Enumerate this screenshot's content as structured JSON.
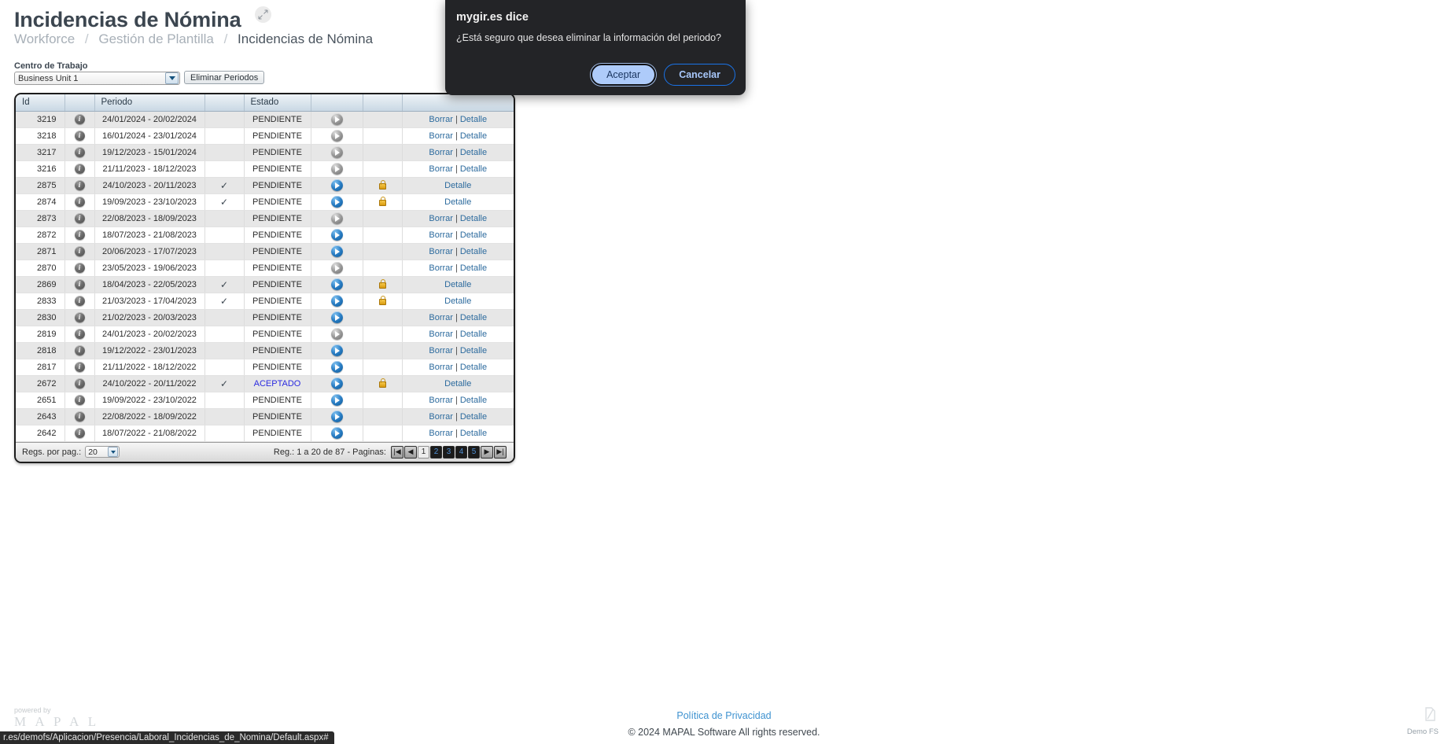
{
  "header": {
    "title": "Incidencias de Nómina",
    "expand_icon": "expand-arrows-icon",
    "breadcrumb": [
      {
        "label": "Workforce",
        "current": false
      },
      {
        "label": "Gestión de Plantilla",
        "current": false
      },
      {
        "label": "Incidencias de Nómina",
        "current": true
      }
    ],
    "separator": "/"
  },
  "filters": {
    "centro_label": "Centro de Trabajo",
    "centro_value": "Business Unit 1",
    "eliminar_button": "Eliminar Periodos"
  },
  "grid": {
    "columns": [
      "Id",
      "",
      "Periodo",
      "",
      "Estado",
      "",
      "",
      ""
    ],
    "rows": [
      {
        "id": "3219",
        "periodo": "24/01/2024 - 20/02/2024",
        "check": "",
        "estado": "PENDIENTE",
        "estado_link": false,
        "arrow": "grey",
        "lock": false,
        "actions": "borrar_detalle"
      },
      {
        "id": "3218",
        "periodo": "16/01/2024 - 23/01/2024",
        "check": "",
        "estado": "PENDIENTE",
        "estado_link": false,
        "arrow": "grey",
        "lock": false,
        "actions": "borrar_detalle"
      },
      {
        "id": "3217",
        "periodo": "19/12/2023 - 15/01/2024",
        "check": "",
        "estado": "PENDIENTE",
        "estado_link": false,
        "arrow": "grey",
        "lock": false,
        "actions": "borrar_detalle"
      },
      {
        "id": "3216",
        "periodo": "21/11/2023 - 18/12/2023",
        "check": "",
        "estado": "PENDIENTE",
        "estado_link": false,
        "arrow": "grey",
        "lock": false,
        "actions": "borrar_detalle"
      },
      {
        "id": "2875",
        "periodo": "24/10/2023 - 20/11/2023",
        "check": "✓",
        "estado": "PENDIENTE",
        "estado_link": false,
        "arrow": "blue",
        "lock": true,
        "actions": "detalle"
      },
      {
        "id": "2874",
        "periodo": "19/09/2023 - 23/10/2023",
        "check": "✓",
        "estado": "PENDIENTE",
        "estado_link": false,
        "arrow": "blue",
        "lock": true,
        "actions": "detalle"
      },
      {
        "id": "2873",
        "periodo": "22/08/2023 - 18/09/2023",
        "check": "",
        "estado": "PENDIENTE",
        "estado_link": false,
        "arrow": "grey",
        "lock": false,
        "actions": "borrar_detalle"
      },
      {
        "id": "2872",
        "periodo": "18/07/2023 - 21/08/2023",
        "check": "",
        "estado": "PENDIENTE",
        "estado_link": false,
        "arrow": "blue",
        "lock": false,
        "actions": "borrar_detalle"
      },
      {
        "id": "2871",
        "periodo": "20/06/2023 - 17/07/2023",
        "check": "",
        "estado": "PENDIENTE",
        "estado_link": false,
        "arrow": "blue",
        "lock": false,
        "actions": "borrar_detalle"
      },
      {
        "id": "2870",
        "periodo": "23/05/2023 - 19/06/2023",
        "check": "",
        "estado": "PENDIENTE",
        "estado_link": false,
        "arrow": "grey",
        "lock": false,
        "actions": "borrar_detalle"
      },
      {
        "id": "2869",
        "periodo": "18/04/2023 - 22/05/2023",
        "check": "✓",
        "estado": "PENDIENTE",
        "estado_link": false,
        "arrow": "blue",
        "lock": true,
        "actions": "detalle"
      },
      {
        "id": "2833",
        "periodo": "21/03/2023 - 17/04/2023",
        "check": "✓",
        "estado": "PENDIENTE",
        "estado_link": false,
        "arrow": "blue",
        "lock": true,
        "actions": "detalle"
      },
      {
        "id": "2830",
        "periodo": "21/02/2023 - 20/03/2023",
        "check": "",
        "estado": "PENDIENTE",
        "estado_link": false,
        "arrow": "blue",
        "lock": false,
        "actions": "borrar_detalle"
      },
      {
        "id": "2819",
        "periodo": "24/01/2023 - 20/02/2023",
        "check": "",
        "estado": "PENDIENTE",
        "estado_link": false,
        "arrow": "grey",
        "lock": false,
        "actions": "borrar_detalle"
      },
      {
        "id": "2818",
        "periodo": "19/12/2022 - 23/01/2023",
        "check": "",
        "estado": "PENDIENTE",
        "estado_link": false,
        "arrow": "blue",
        "lock": false,
        "actions": "borrar_detalle"
      },
      {
        "id": "2817",
        "periodo": "21/11/2022 - 18/12/2022",
        "check": "",
        "estado": "PENDIENTE",
        "estado_link": false,
        "arrow": "blue",
        "lock": false,
        "actions": "borrar_detalle"
      },
      {
        "id": "2672",
        "periodo": "24/10/2022 - 20/11/2022",
        "check": "✓",
        "estado": "ACEPTADO",
        "estado_link": true,
        "arrow": "blue",
        "lock": true,
        "actions": "detalle"
      },
      {
        "id": "2651",
        "periodo": "19/09/2022 - 23/10/2022",
        "check": "",
        "estado": "PENDIENTE",
        "estado_link": false,
        "arrow": "blue",
        "lock": false,
        "actions": "borrar_detalle"
      },
      {
        "id": "2643",
        "periodo": "22/08/2022 - 18/09/2022",
        "check": "",
        "estado": "PENDIENTE",
        "estado_link": false,
        "arrow": "blue",
        "lock": false,
        "actions": "borrar_detalle"
      },
      {
        "id": "2642",
        "periodo": "18/07/2022 - 21/08/2022",
        "check": "",
        "estado": "PENDIENTE",
        "estado_link": false,
        "arrow": "blue",
        "lock": false,
        "actions": "borrar_detalle"
      }
    ],
    "action_labels": {
      "borrar": "Borrar",
      "detalle": "Detalle",
      "separator": "|"
    }
  },
  "grid_footer": {
    "per_page_label": "Regs. por pag.:",
    "per_page_value": "20",
    "record_info": "Reg.: 1 a 20 de 87 - Paginas:",
    "nav_first": "first-page-icon",
    "nav_prev": "previous-page-icon",
    "nav_next": "next-page-icon",
    "nav_last": "last-page-icon",
    "pages": [
      "1",
      "2",
      "3",
      "4",
      "5"
    ],
    "active_page": "1"
  },
  "dialog": {
    "title": "mygir.es dice",
    "message": "¿Está seguro que desea eliminar la información del periodo?",
    "accept_label": "Aceptar",
    "cancel_label": "Cancelar"
  },
  "footer": {
    "privacy_link": "Política de Privacidad",
    "copyright": "© 2024 MAPAL Software All rights reserved.",
    "powered_by": "powered by",
    "brand": "M A P A L",
    "demo_label": "Demo FS"
  },
  "status_bar": {
    "url": "r.es/demofs/Aplicacion/Presencia/Laboral_Incidencias_de_Nomina/Default.aspx#"
  }
}
